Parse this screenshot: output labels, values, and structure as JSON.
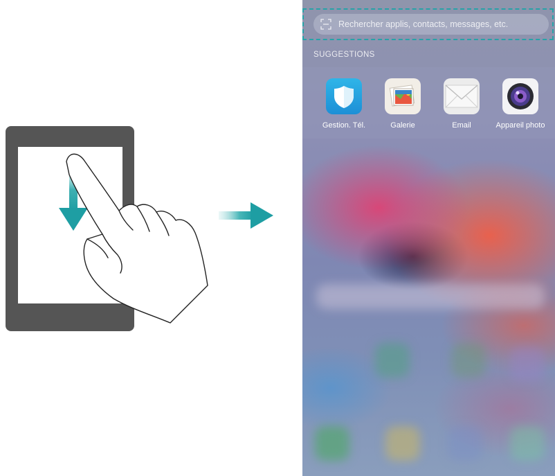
{
  "search": {
    "placeholder": "Rechercher applis, contacts, messages, etc."
  },
  "suggestions": {
    "title": "SUGGESTIONS",
    "apps": [
      {
        "label": "Gestion. Tél.",
        "icon": "shield-icon"
      },
      {
        "label": "Galerie",
        "icon": "gallery-icon"
      },
      {
        "label": "Email",
        "icon": "envelope-icon"
      },
      {
        "label": "Appareil photo",
        "icon": "camera-icon"
      }
    ]
  },
  "colors": {
    "accent": "#27a3a8",
    "tablet": "#555555"
  }
}
